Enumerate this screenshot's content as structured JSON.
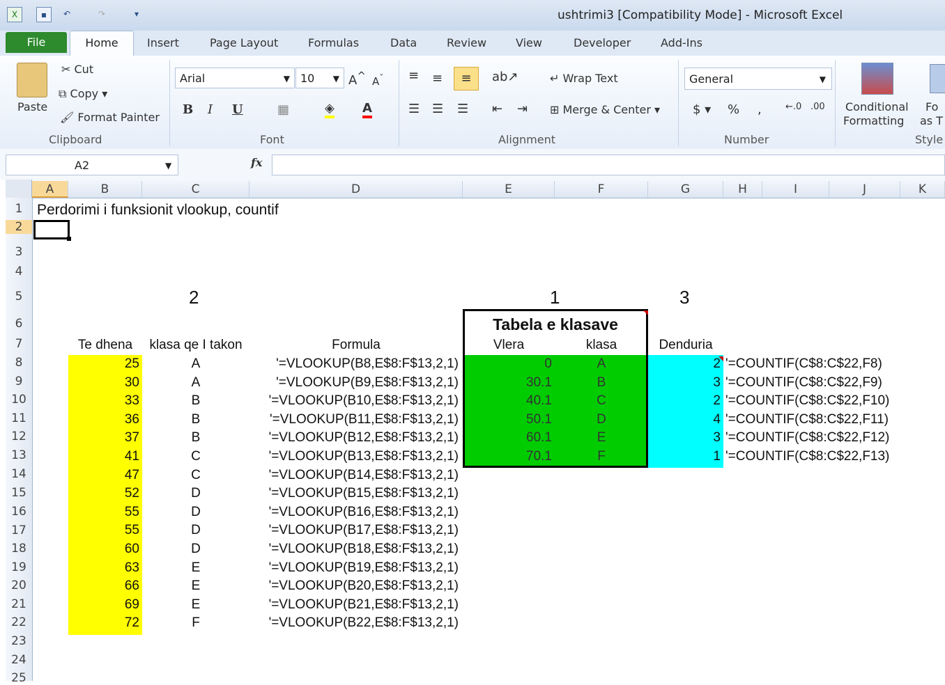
{
  "title": "ushtrimi3  [Compatibility Mode]  -  Microsoft Excel",
  "tabs": [
    "File",
    "Home",
    "Insert",
    "Page Layout",
    "Formulas",
    "Data",
    "Review",
    "View",
    "Developer",
    "Add-Ins"
  ],
  "clipboard": {
    "paste": "Paste",
    "cut": "Cut",
    "copy": "Copy",
    "format_painter": "Format Painter",
    "label": "Clipboard"
  },
  "font": {
    "name": "Arial",
    "size": "10",
    "label": "Font"
  },
  "alignment": {
    "wrap": "Wrap Text",
    "merge": "Merge & Center",
    "label": "Alignment"
  },
  "number": {
    "format": "General",
    "label": "Number"
  },
  "styles": {
    "cond1": "Conditional",
    "cond2": "Formatting",
    "fo": "Fo",
    "ast": "as T",
    "label": "Style"
  },
  "formula_bar": {
    "name_box": "A2",
    "fx": "fx",
    "content": ""
  },
  "columns": [
    "A",
    "B",
    "C",
    "D",
    "E",
    "F",
    "G",
    "H",
    "I",
    "J",
    "K"
  ],
  "rows": [
    "1",
    "2",
    "3",
    "4",
    "5",
    "6",
    "7",
    "8",
    "9",
    "10",
    "11",
    "12",
    "13",
    "14",
    "15",
    "16",
    "17",
    "18",
    "19",
    "20",
    "21",
    "22",
    "23",
    "24",
    "25"
  ],
  "sheet": {
    "title": "Perdorimi i funksionit vlookup, countif",
    "num_c5": "2",
    "num_e5": "1",
    "num_g5": "3",
    "table_title": "Tabela e klasave",
    "headers": {
      "b": "Te dhena",
      "c": "klasa qe I takon",
      "d": "Formula",
      "e": "Vlera",
      "f": "klasa",
      "g": "Denduria"
    },
    "data_b": [
      "25",
      "30",
      "33",
      "36",
      "37",
      "41",
      "47",
      "52",
      "55",
      "55",
      "60",
      "63",
      "66",
      "69",
      "72"
    ],
    "data_c": [
      "A",
      "A",
      "B",
      "B",
      "B",
      "C",
      "C",
      "D",
      "D",
      "D",
      "D",
      "E",
      "E",
      "E",
      "F"
    ],
    "data_d": [
      "'=VLOOKUP(B8,E$8:F$13,2,1)",
      "'=VLOOKUP(B9,E$8:F$13,2,1)",
      "'=VLOOKUP(B10,E$8:F$13,2,1)",
      "'=VLOOKUP(B11,E$8:F$13,2,1)",
      "'=VLOOKUP(B12,E$8:F$13,2,1)",
      "'=VLOOKUP(B13,E$8:F$13,2,1)",
      "'=VLOOKUP(B14,E$8:F$13,2,1)",
      "'=VLOOKUP(B15,E$8:F$13,2,1)",
      "'=VLOOKUP(B16,E$8:F$13,2,1)",
      "'=VLOOKUP(B17,E$8:F$13,2,1)",
      "'=VLOOKUP(B18,E$8:F$13,2,1)",
      "'=VLOOKUP(B19,E$8:F$13,2,1)",
      "'=VLOOKUP(B20,E$8:F$13,2,1)",
      "'=VLOOKUP(B21,E$8:F$13,2,1)",
      "'=VLOOKUP(B22,E$8:F$13,2,1)"
    ],
    "data_e": [
      "0",
      "30.1",
      "40.1",
      "50.1",
      "60.1",
      "70.1"
    ],
    "data_f": [
      "A",
      "B",
      "C",
      "D",
      "E",
      "F"
    ],
    "data_g": [
      "2",
      "3",
      "2",
      "4",
      "3",
      "1"
    ],
    "data_h": [
      "'=COUNTIF(C$8:C$22,F8)",
      "'=COUNTIF(C$8:C$22,F9)",
      "'=COUNTIF(C$8:C$22,F10)",
      "'=COUNTIF(C$8:C$22,F11)",
      "'=COUNTIF(C$8:C$22,F12)",
      "'=COUNTIF(C$8:C$22,F13)"
    ]
  },
  "colors": {
    "yellow": "#ffff00",
    "green": "#00cc00",
    "cyan": "#00ffff",
    "file_tab": "#2d8a2d"
  }
}
